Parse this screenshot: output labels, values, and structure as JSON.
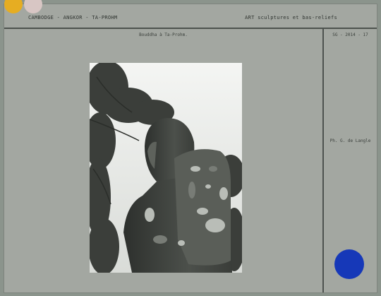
{
  "header": {
    "left": "CAMBODGE - ANGKOR - TA-PROHM",
    "right": "ART sculptures et bas-reliefs"
  },
  "caption": "Bouddha à Ta-Prohm.",
  "reference": "SG - 2014 - 17",
  "credit": "Ph. G. de Langle",
  "photo": {
    "subject": "stone-buddha-statue-photo"
  },
  "colors": {
    "sticker_yellow": "#e6ad22",
    "sticker_pink": "#d8c6c4",
    "stamp_blue": "#1638b8",
    "card": "#a3a7a1"
  }
}
